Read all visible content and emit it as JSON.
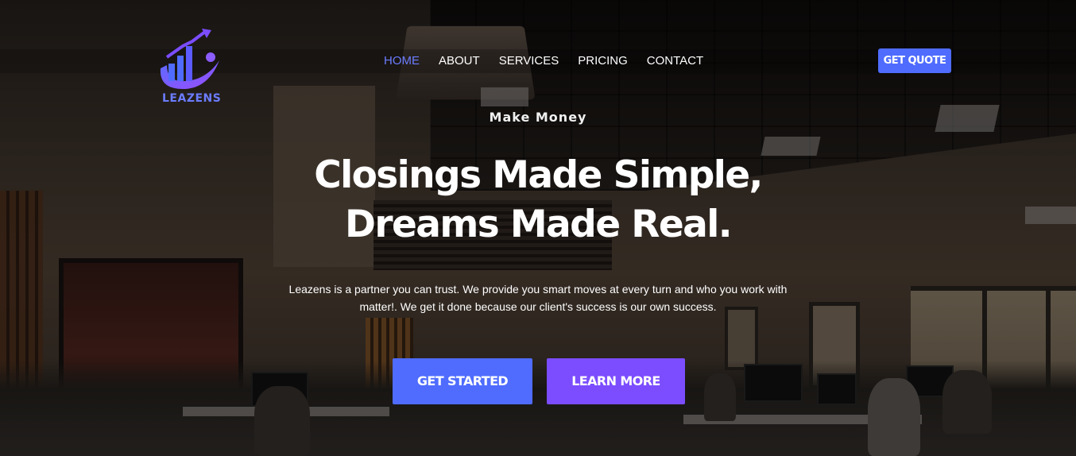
{
  "brand": {
    "name": "LEAZENS",
    "accent": "#6b7cff",
    "purple": "#7b4dff",
    "blue": "#4f6cff"
  },
  "nav": {
    "items": [
      {
        "label": "HOME",
        "active": true
      },
      {
        "label": "ABOUT",
        "active": false
      },
      {
        "label": "SERVICES",
        "active": false
      },
      {
        "label": "PRICING",
        "active": false
      },
      {
        "label": "CONTACT",
        "active": false
      }
    ],
    "cta_label": "GET QUOTE"
  },
  "hero": {
    "kicker": "Make Money",
    "headline": "Closings Made Simple, Dreams Made Real.",
    "lede": "Leazens is a partner you can trust. We provide you smart moves at every turn and who you work with matter!. We get it done because our client's success is our own success.",
    "primary_button": "GET STARTED",
    "secondary_button": "LEARN MORE"
  },
  "icons": {
    "logo": "bar-chart-growth-icon"
  }
}
